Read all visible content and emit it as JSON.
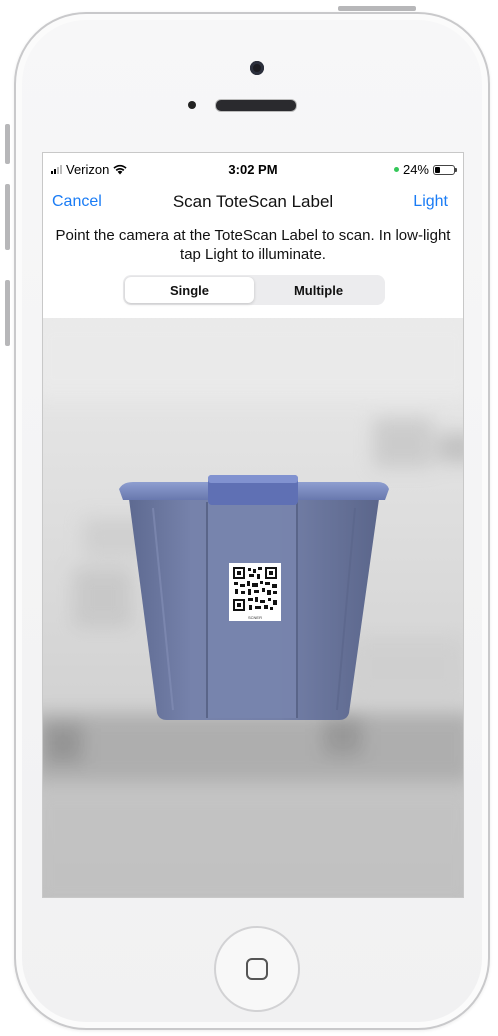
{
  "status_bar": {
    "carrier": "Verizon",
    "time": "3:02 PM",
    "battery": "24%"
  },
  "nav": {
    "cancel_label": "Cancel",
    "title": "Scan ToteScan Label",
    "light_label": "Light"
  },
  "instruction": "Point the camera at the ToteScan Label to scan. In low-light tap Light to illuminate.",
  "segmented": {
    "options": [
      "Single",
      "Multiple"
    ],
    "selected": "Single"
  },
  "qr_label": {
    "caption": "SCNER"
  },
  "colors": {
    "accent": "#1a7cf5",
    "battery_dot": "#34c759",
    "tote_blue": "#707da6"
  },
  "icons": [
    "signal-bars-icon",
    "wifi-icon",
    "battery-icon",
    "home-button-icon"
  ]
}
